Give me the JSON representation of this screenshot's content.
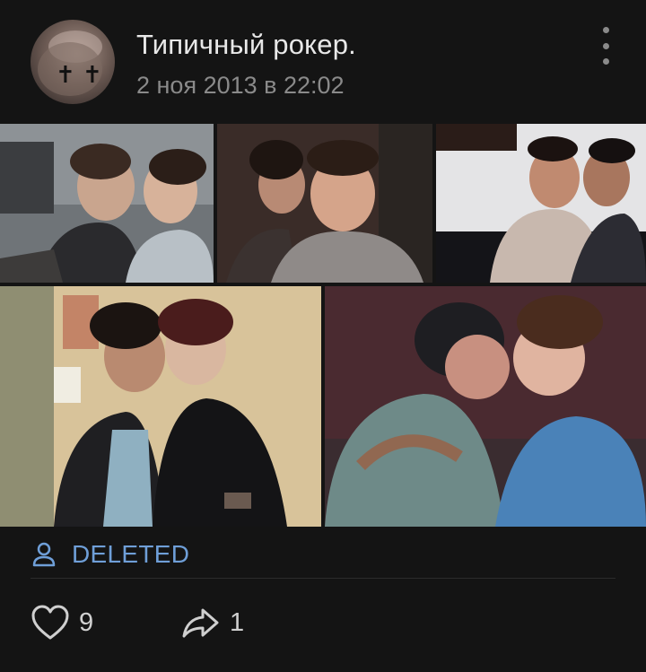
{
  "post": {
    "author": "Типичный рокер.",
    "date": "2 ноя 2013 в 22:02",
    "source_name": "DELETED",
    "likes": "9",
    "shares": "1"
  },
  "icons": {
    "avatar_glyphs": [
      "✝",
      "✝"
    ],
    "more": "more-vertical-icon",
    "source": "person-icon",
    "like": "heart-icon",
    "share": "share-arrow-icon"
  },
  "colors": {
    "background": "#141414",
    "author": "#e8e8e8",
    "muted": "#8a8a8a",
    "link": "#6f9fd8"
  }
}
